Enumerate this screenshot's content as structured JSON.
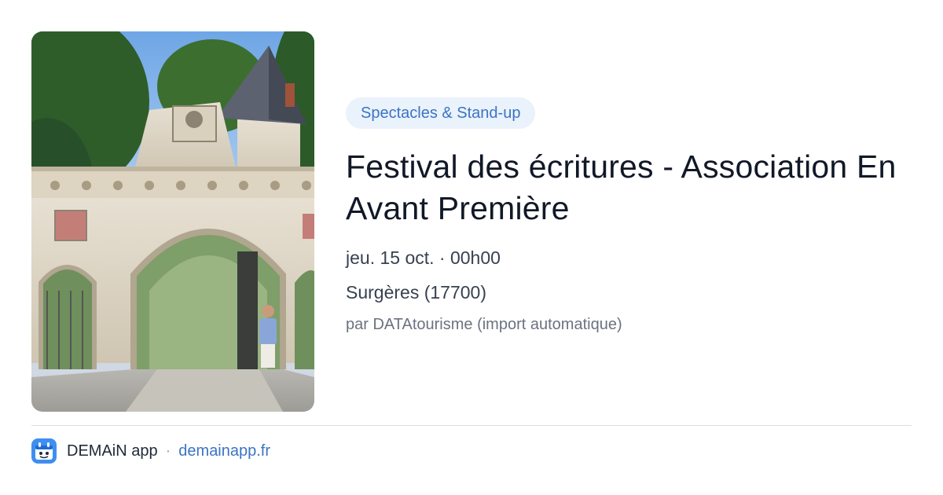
{
  "event": {
    "category": "Spectacles & Stand-up",
    "title": "Festival des écritures - Association En Avant Première",
    "date": "jeu. 15 oct. · 00h00",
    "location": "Surgères (17700)",
    "source": "par DATAtourisme (import automatique)",
    "image_subject": "stone gate arch with round tower"
  },
  "footer": {
    "app_name": "DEMAiN app",
    "separator": "·",
    "domain": "demainapp.fr",
    "app_icon": "demain-app-icon"
  },
  "colors": {
    "accent": "#3b74c4",
    "badge_bg": "#eaf2fc",
    "title": "#111827",
    "muted": "#6b7280",
    "divider": "#d9dee5"
  }
}
